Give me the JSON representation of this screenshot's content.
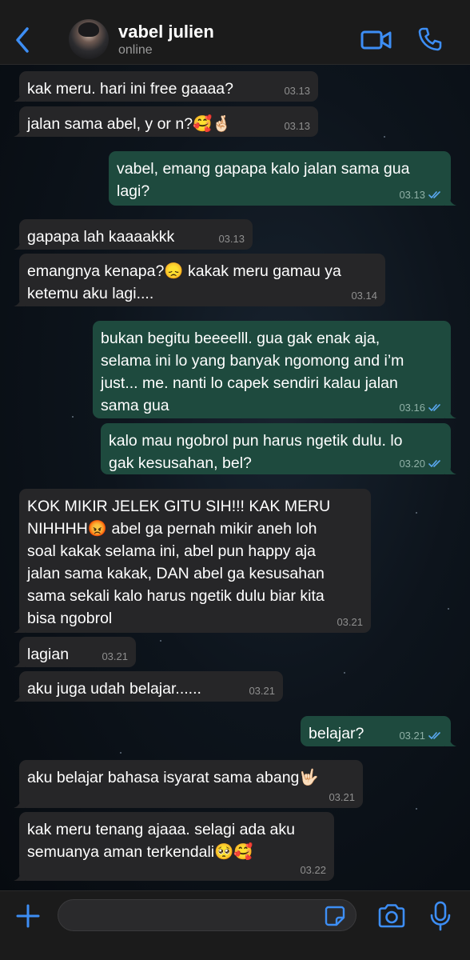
{
  "header": {
    "contact_name": "vabel julien",
    "status": "online"
  },
  "colors": {
    "accent": "#3d8ef5",
    "incoming_bubble": "#262628",
    "outgoing_bubble": "#1e4a3e",
    "read_tick": "#5aa8f0"
  },
  "messages": [
    {
      "direction": "in",
      "text": "kak meru. hari ini free gaaaa?",
      "time": "03.13"
    },
    {
      "direction": "in",
      "text": "jalan sama abel, y or n?🥰🤞🏻",
      "time": "03.13"
    },
    {
      "direction": "out",
      "text": "vabel, emang gapapa kalo jalan sama gua\nlagi?",
      "time": "03.13",
      "read": true
    },
    {
      "direction": "in",
      "text": "gapapa lah kaaaakkk",
      "time": "03.13"
    },
    {
      "direction": "in",
      "text": "emangnya kenapa?😞 kakak meru gamau ya\nketemu aku lagi....",
      "time": "03.14"
    },
    {
      "direction": "out",
      "text": "bukan begitu beeeelll. gua gak enak aja,\nselama ini lo yang banyak ngomong and i’m\njust... me. nanti lo capek sendiri kalau jalan\nsama gua",
      "time": "03.16",
      "read": true
    },
    {
      "direction": "out",
      "text": "kalo mau ngobrol pun harus ngetik dulu. lo\ngak kesusahan, bel?",
      "time": "03.20",
      "read": true
    },
    {
      "direction": "in",
      "text": "KOK MIKIR JELEK GITU SIH!!! KAK MERU\nNIHHHH😡 abel ga pernah mikir aneh loh\nsoal kakak selama ini, abel pun happy aja\njalan sama kakak, DAN abel ga kesusahan\nsama sekali kalo harus ngetik dulu biar kita\nbisa ngobrol",
      "time": "03.21"
    },
    {
      "direction": "in",
      "text": "lagian",
      "time": "03.21"
    },
    {
      "direction": "in",
      "text": "aku juga udah belajar......",
      "time": "03.21"
    },
    {
      "direction": "out",
      "text": "belajar?",
      "time": "03.21",
      "read": true
    },
    {
      "direction": "in",
      "text": "aku belajar bahasa isyarat sama abang🤟🏻",
      "time": "03.21"
    },
    {
      "direction": "in",
      "text": "kak meru tenang ajaaa. selagi ada aku\nsemuanya aman terkendali🥺🥰",
      "time": "03.22"
    }
  ],
  "input": {
    "value": "",
    "placeholder": ""
  },
  "icons": {
    "back": "chevron-left-icon",
    "video": "video-camera-icon",
    "call": "phone-icon",
    "attach": "plus-icon",
    "sticker": "sticker-icon",
    "camera": "camera-icon",
    "mic": "microphone-icon"
  }
}
